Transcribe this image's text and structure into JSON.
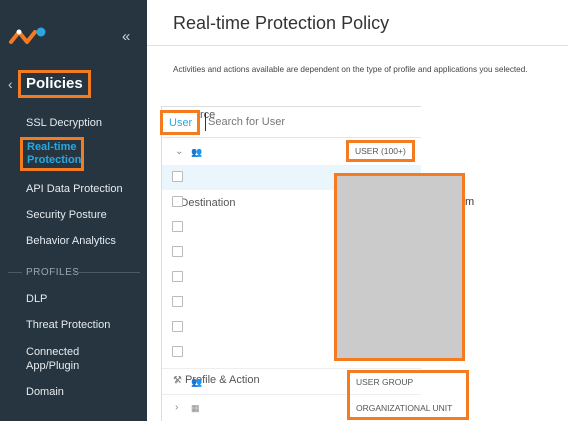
{
  "sidebar": {
    "collapse_glyph": "«",
    "back_glyph": "‹",
    "section_title": "Policies",
    "items": [
      {
        "label": "SSL Decryption"
      },
      {
        "label": "Real-time Protection"
      },
      {
        "label": "API Data Protection"
      },
      {
        "label": "Security Posture"
      },
      {
        "label": "Behavior Analytics"
      }
    ],
    "profiles_heading": "PROFILES",
    "profile_items": [
      {
        "label": "DLP"
      },
      {
        "label": "Threat Protection"
      },
      {
        "label": "Connected App/Plugin"
      },
      {
        "label": "Domain"
      }
    ]
  },
  "main": {
    "title": "Real-time Protection Policy",
    "subtitle": "Activities and actions available are dependent on the type of profile and applications you selected.",
    "source_label": "Source",
    "destination_label": "Destination",
    "profile_action_label": "Profile & Action",
    "picker": {
      "tag": "User",
      "search_placeholder": "Search for User",
      "groups": [
        {
          "label": "USER (100+)"
        },
        {
          "label": "USER GROUP"
        },
        {
          "label": "ORGANIZATIONAL UNIT"
        }
      ],
      "partial_row_suffix": "m"
    }
  },
  "colors": {
    "sidebar_bg": "#263540",
    "accent_blue": "#29a8e0",
    "highlight_orange": "#f47b20"
  },
  "icons": {
    "collapse": "chevrons-left-icon",
    "back": "chevron-left-icon",
    "source": "upload-icon",
    "destination": "download-icon",
    "profile_action": "gavel-icon",
    "group": "users-icon",
    "org": "org-chart-icon"
  }
}
